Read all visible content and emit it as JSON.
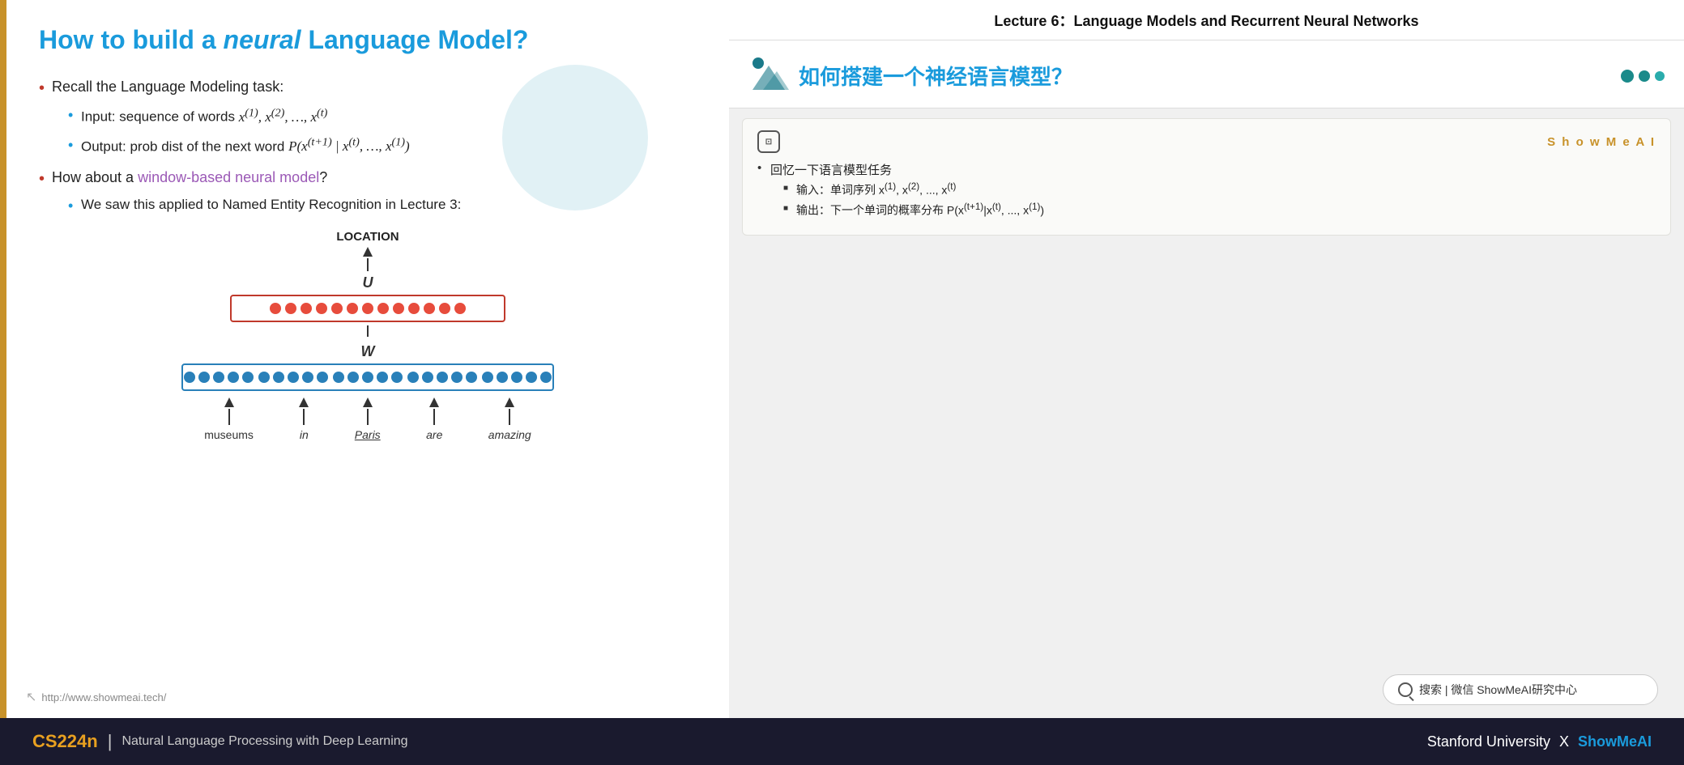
{
  "slide": {
    "title_part1": "How to build a ",
    "title_italic": "neural",
    "title_part2": " Language Model?",
    "bullets": [
      {
        "text": "Recall the Language Modeling task:",
        "sub": [
          "Input: sequence of words x(1), x(2), …, x(t)",
          "Output: prob dist of the next word P(x(t+1) | x(t), …, x(1))"
        ]
      },
      {
        "text": "How about a window-based neural model?",
        "sub": [
          "We saw this applied to Named Entity Recognition in Lecture 3:"
        ]
      }
    ],
    "diagram": {
      "location_label": "LOCATION",
      "u_label": "U",
      "w_label": "W",
      "red_dots_count": 13,
      "blue_groups": [
        5,
        5,
        5,
        5,
        5
      ],
      "word_labels": [
        "museums",
        "in",
        "Paris",
        "are",
        "amazing"
      ]
    },
    "footer_link": "http://www.showmeai.tech/"
  },
  "lecture_header": {
    "title": "Lecture 6：Language Models and Recurrent Neural Networks"
  },
  "translation": {
    "chinese_title": "如何搭建一个神经语言模型？"
  },
  "showmeai_box": {
    "ai_icon_text": "⊡",
    "brand": "S h o w M e A I",
    "bullets": [
      {
        "text": "回忆一下语言模型任务",
        "sub": [
          "输入：单词序列 x(1), x(2), ..., x(t)",
          "输出：下一个单词的概率分布 P(x(t+1)|x(t), ..., x(1))"
        ]
      }
    ]
  },
  "search": {
    "label": "搜索 | 微信 ShowMeAI研究中心"
  },
  "footer": {
    "course": "CS224n",
    "divider": "|",
    "description": "Natural Language Processing with Deep Learning",
    "right_text": "Stanford University",
    "x": "X",
    "brand": "ShowMeAI"
  }
}
